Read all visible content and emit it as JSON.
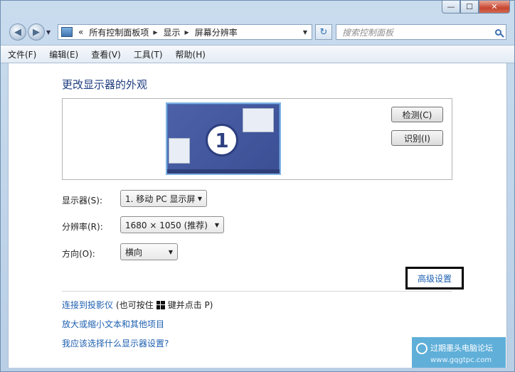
{
  "window": {
    "caption": {
      "minimize": "—",
      "maximize": "☐",
      "close": "✕"
    }
  },
  "nav": {
    "back_glyph": "◀",
    "forward_glyph": "▶",
    "breadcrumb_prefix": "«",
    "breadcrumb": [
      "所有控制面板项",
      "显示",
      "屏幕分辨率"
    ],
    "refresh_glyph": "↻",
    "search_placeholder": "搜索控制面板"
  },
  "menu": [
    "文件(F)",
    "编辑(E)",
    "查看(V)",
    "工具(T)",
    "帮助(H)"
  ],
  "main": {
    "heading": "更改显示器的外观",
    "monitor_number": "1",
    "detect_label": "检测(C)",
    "identify_label": "识别(I)",
    "display_label": "显示器(S):",
    "display_value": "1. 移动 PC 显示屏",
    "resolution_label": "分辨率(R):",
    "resolution_value": "1680 × 1050 (推荐)",
    "orientation_label": "方向(O):",
    "orientation_value": "横向",
    "advanced_link": "高级设置",
    "projector_link": "连接到投影仪",
    "projector_hint_pre": "(也可按住",
    "projector_hint_post": "键并点击 P)",
    "text_size_link": "放大或缩小文本和其他项目",
    "which_settings_link": "我应该选择什么显示器设置?"
  },
  "watermark": {
    "title": "过期墨头电脑论坛",
    "url": "www.gqgtpc.com"
  },
  "colors": {
    "link": "#1d5fb0",
    "heading": "#1e3d80",
    "monitor": "#3b4f95",
    "close_button": "#c7452f"
  },
  "icons": [
    "back-arrow-icon",
    "forward-arrow-icon",
    "control-panel-icon",
    "refresh-icon",
    "search-icon",
    "windows-logo-icon",
    "chevron-down-icon"
  ]
}
